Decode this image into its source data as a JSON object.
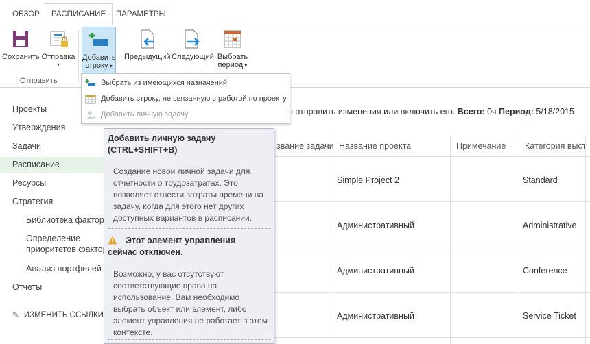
{
  "tabs": [
    "ОБЗОР",
    "РАСПИСАНИЕ",
    "ПАРАМЕТРЫ"
  ],
  "ribbon": {
    "save": "Сохранить",
    "send": "Отправка",
    "add_row_1": "Добавить",
    "add_row_2": "строку",
    "prev": "Предыдущий",
    "next": "Следующий",
    "select_1": "Выбрать",
    "select_2": "период",
    "group_label": "Отправить"
  },
  "menu": {
    "items": [
      "Выбрать из имеющихся назначений",
      "Добавить строку, не связанную с работой по проекту",
      "Добавить личную задачу"
    ]
  },
  "nav": {
    "items": [
      "Проекты",
      "Утверждения",
      "Задачи",
      "Расписание",
      "Ресурсы",
      "Стратегия"
    ],
    "sub": [
      "Библиотека факторов",
      "Определение",
      "приоритетов факторов",
      "Анализ портфелей"
    ],
    "reports": "Отчеты",
    "edit_links": "ИЗМЕНИТЬ ССЫЛКИ"
  },
  "status": {
    "prefix": "о отправить изменения или включить его.",
    "total_label": "Всего:",
    "total_value": "0ч",
    "period_label": "Период:",
    "period_value": "5/18/2015"
  },
  "grid": {
    "headers": [
      "звание задачи",
      "Название проекта",
      "Примечание",
      "Категория выст"
    ],
    "rows": [
      {
        "project": "Simple Project 2",
        "category": "Standard"
      },
      {
        "project": "Административный",
        "category": "Administrative"
      },
      {
        "project": "Административный",
        "category": "Conference"
      },
      {
        "project": "Административный",
        "category": "Service Ticket"
      }
    ]
  },
  "tooltip": {
    "title_1": "Добавить личную задачу",
    "title_2": "(CTRL+SHIFT+B)",
    "body_1": "Создание новой личной задачи для отчетности о трудозатратах. Это позволяет отнести затраты времени на задачу, когда для этого нет других доступных вариантов в расписании.",
    "warn_1": "Этот элемент управления",
    "warn_2": "сейчас отключен.",
    "body_2": "Возможно, у вас отсутствуют соответствующие права на использование. Вам необходимо выбрать объект или элемент, либо элемент управления не работает в этом контексте."
  },
  "colors": {
    "accent": "#2a8dd4",
    "save_purple": "#80397b",
    "active_nav_bg": "#e7f3e9",
    "tooltip_bg": "#eeeef5"
  }
}
